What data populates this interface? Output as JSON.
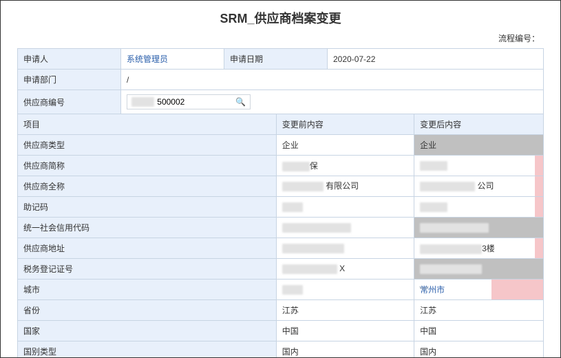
{
  "title": "SRM_供应商档案变更",
  "flow_label": "流程编号：",
  "header": {
    "applicant_label": "申请人",
    "applicant_value": "系统管理员",
    "apply_date_label": "申请日期",
    "apply_date_value": "2020-07-22",
    "dept_label": "申请部门",
    "dept_value": "/",
    "supplier_code_label": "供应商编号",
    "supplier_code_value": "500002"
  },
  "cols": {
    "item": "项目",
    "before": "变更前内容",
    "after": "变更后内容"
  },
  "rows": [
    {
      "label": "供应商类型",
      "before_text": "企业",
      "after_text": "企业",
      "after_style": "gray"
    },
    {
      "label": "供应商简称",
      "before_text": "▮▮▮▮保",
      "after_text": "▮▮▮▮",
      "after_style": "pink-edge"
    },
    {
      "label": "供应商全称",
      "before_text": "▮▮▮▮▮▮ 有限公司",
      "after_text": "▮▮▮▮▮▮▮▮ 公司",
      "after_style": "pink-edge",
      "twoline": true
    },
    {
      "label": "助记码",
      "before_text": "▮▮▮",
      "after_text": "▮▮▮▮",
      "after_style": "pink-edge"
    },
    {
      "label": "统一社会信用代码",
      "before_text": "▮▮▮▮▮▮▮▮▮▮",
      "after_text": "▮▮▮▮▮▮▮▮▮▮",
      "after_style": "gray"
    },
    {
      "label": "供应商地址",
      "before_text": "▮▮▮▮▮▮▮▮▮",
      "after_text": "▮▮▮▮▮▮▮▮▮3楼",
      "after_style": "pink-edge"
    },
    {
      "label": "税务登记证号",
      "before_text": "▮▮▮▮▮▮▮▮ X",
      "after_text": "▮▮▮▮▮▮▮▮▮",
      "after_style": "gray"
    },
    {
      "label": "城市",
      "before_text": "▮▮▮",
      "after_text": "常州市",
      "after_style": "pink-select"
    },
    {
      "label": "省份",
      "before_text": "江苏",
      "after_text": "江苏",
      "after_style": "plain"
    },
    {
      "label": "国家",
      "before_text": "中国",
      "after_text": "中国",
      "after_style": "plain"
    },
    {
      "label": "国别类型",
      "before_text": "国内",
      "after_text": "国内",
      "after_style": "plain"
    }
  ],
  "chart_data": {
    "type": "table",
    "title": "SRM_供应商档案变更",
    "columns": [
      "项目",
      "变更前内容",
      "变更后内容"
    ],
    "rows": [
      [
        "供应商类型",
        "企业",
        "企业"
      ],
      [
        "供应商简称",
        "(redacted)保",
        "(redacted)"
      ],
      [
        "供应商全称",
        "(redacted) 有限公司",
        "(redacted) 公司"
      ],
      [
        "助记码",
        "(redacted)",
        "(redacted)"
      ],
      [
        "统一社会信用代码",
        "(redacted)",
        "(redacted)"
      ],
      [
        "供应商地址",
        "(redacted)",
        "(redacted)3楼"
      ],
      [
        "税务登记证号",
        "(redacted) X",
        "(redacted)"
      ],
      [
        "城市",
        "(redacted)",
        "常州市"
      ],
      [
        "省份",
        "江苏",
        "江苏"
      ],
      [
        "国家",
        "中国",
        "中国"
      ],
      [
        "国别类型",
        "国内",
        "国内"
      ]
    ],
    "meta": {
      "申请人": "系统管理员",
      "申请日期": "2020-07-22",
      "申请部门": "/",
      "供应商编号": "500002"
    }
  }
}
